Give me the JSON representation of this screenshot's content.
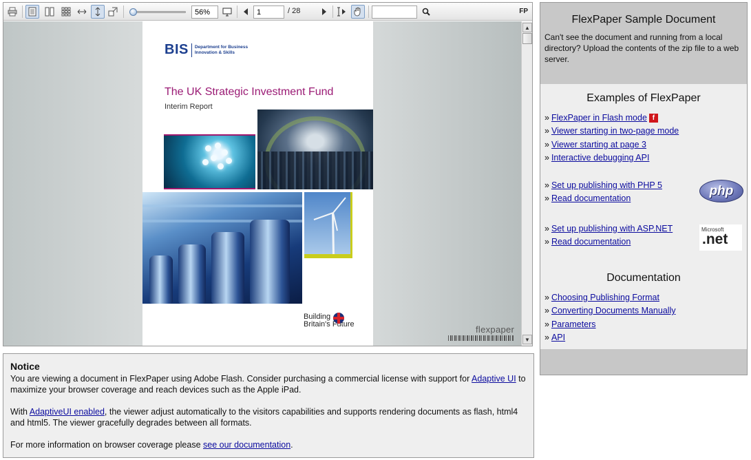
{
  "toolbar": {
    "zoom_value": "56%",
    "page_value": "1",
    "page_total": "/ 28",
    "search_value": "",
    "brand": "FP"
  },
  "document": {
    "org_letters": "BIS",
    "org_name": "Department for Business Innovation & Skills",
    "title": "The UK Strategic Investment Fund",
    "subtitle": "Interim Report",
    "footer_line1": "Building",
    "footer_line2": "Britain's Future",
    "watermark": "flexpaper"
  },
  "sidebar": {
    "title": "FlexPaper Sample Document",
    "intro": "Can't see the document and running from a local directory? Upload the contents of the zip file to a web server.",
    "examples_heading": "Examples of FlexPaper",
    "examples": [
      "FlexPaper in Flash mode",
      "Viewer starting in two-page mode",
      "Viewer starting at page 3",
      "Interactive debugging API"
    ],
    "php_links": [
      "Set up publishing with PHP 5",
      "Read documentation"
    ],
    "php_logo": "php",
    "net_links": [
      "Set up publishing with ASP.NET",
      "Read documentation"
    ],
    "net_logo_top": "Microsoft",
    "net_logo_main": ".net",
    "docs_heading": "Documentation",
    "docs": [
      "Choosing Publishing Format",
      "Converting Documents Manually",
      "Parameters",
      "API"
    ]
  },
  "notice": {
    "heading": "Notice",
    "p1_a": "You are viewing a document in FlexPaper using Adobe Flash. Consider purchasing a commercial license with support for ",
    "p1_link": "Adaptive UI",
    "p1_b": " to maximize your browser coverage and reach devices such as the Apple iPad.",
    "p2_a": "With ",
    "p2_link": "AdaptiveUI enabled",
    "p2_b": ", the viewer adjust automatically to the visitors capabilities and supports rendering documents as flash, html4 and html5. The viewer gracefully degrades between all formats.",
    "p3_a": "For more information on browser coverage please ",
    "p3_link": "see our documentation",
    "p3_b": "."
  }
}
